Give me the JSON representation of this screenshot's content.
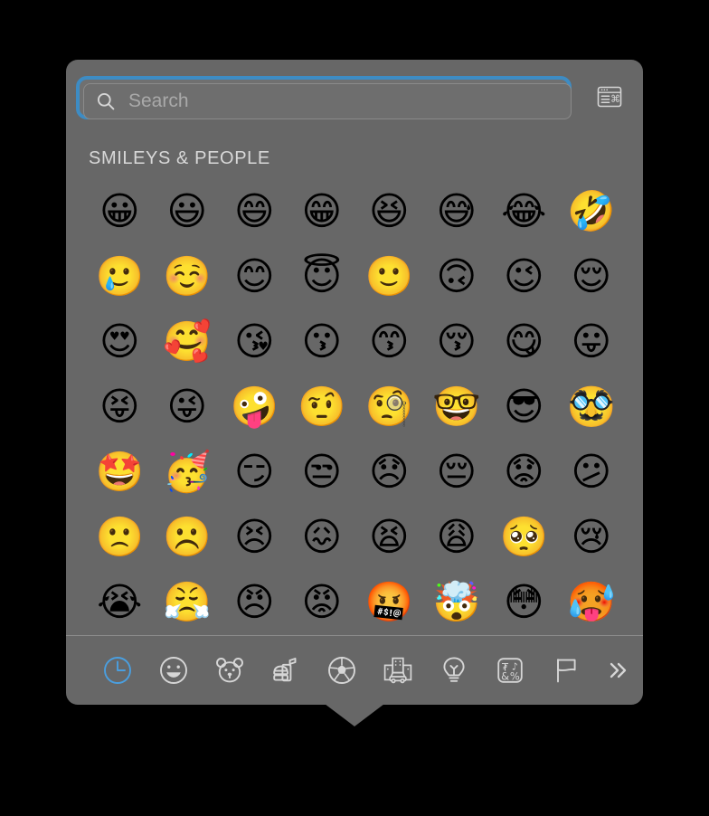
{
  "window": {
    "title": "Emoji Picker",
    "background_color": "#000000",
    "panel_color": "#676767",
    "accent_color": "#3d8cc4"
  },
  "search": {
    "value": "",
    "placeholder": "Search",
    "icon": "search-icon",
    "focused": true,
    "focus_ring_color": "#3d8cc4"
  },
  "char_viewer": {
    "icon": "character-viewer-icon",
    "label": "",
    "glyph": "⌘"
  },
  "section": {
    "header": "SMILEYS & PEOPLE"
  },
  "grid": {
    "columns": 8,
    "rows": 7,
    "emojis": [
      {
        "glyph": "😀",
        "name": "grinning-face"
      },
      {
        "glyph": "😃",
        "name": "grinning-face-with-big-eyes"
      },
      {
        "glyph": "😄",
        "name": "grinning-face-with-smiling-eyes"
      },
      {
        "glyph": "😁",
        "name": "beaming-face-with-smiling-eyes"
      },
      {
        "glyph": "😆",
        "name": "grinning-squinting-face"
      },
      {
        "glyph": "😅",
        "name": "grinning-face-with-sweat"
      },
      {
        "glyph": "😂",
        "name": "face-with-tears-of-joy"
      },
      {
        "glyph": "🤣",
        "name": "rolling-on-the-floor-laughing"
      },
      {
        "glyph": "🥲",
        "name": "smiling-face-with-tear"
      },
      {
        "glyph": "☺️",
        "name": "smiling-face"
      },
      {
        "glyph": "😊",
        "name": "smiling-face-with-smiling-eyes"
      },
      {
        "glyph": "😇",
        "name": "smiling-face-with-halo"
      },
      {
        "glyph": "🙂",
        "name": "slightly-smiling-face"
      },
      {
        "glyph": "🙃",
        "name": "upside-down-face"
      },
      {
        "glyph": "😉",
        "name": "winking-face"
      },
      {
        "glyph": "😌",
        "name": "relieved-face"
      },
      {
        "glyph": "😍",
        "name": "smiling-face-with-heart-eyes"
      },
      {
        "glyph": "🥰",
        "name": "smiling-face-with-hearts"
      },
      {
        "glyph": "😘",
        "name": "face-blowing-a-kiss"
      },
      {
        "glyph": "😗",
        "name": "kissing-face"
      },
      {
        "glyph": "😙",
        "name": "kissing-face-with-smiling-eyes"
      },
      {
        "glyph": "😚",
        "name": "kissing-face-with-closed-eyes"
      },
      {
        "glyph": "😋",
        "name": "face-savoring-food"
      },
      {
        "glyph": "😛",
        "name": "face-with-tongue"
      },
      {
        "glyph": "😝",
        "name": "squinting-face-with-tongue"
      },
      {
        "glyph": "😜",
        "name": "winking-face-with-tongue"
      },
      {
        "glyph": "🤪",
        "name": "zany-face"
      },
      {
        "glyph": "🤨",
        "name": "face-with-raised-eyebrow"
      },
      {
        "glyph": "🧐",
        "name": "face-with-monocle"
      },
      {
        "glyph": "🤓",
        "name": "nerd-face"
      },
      {
        "glyph": "😎",
        "name": "smiling-face-with-sunglasses"
      },
      {
        "glyph": "🥸",
        "name": "disguised-face"
      },
      {
        "glyph": "🤩",
        "name": "star-struck"
      },
      {
        "glyph": "🥳",
        "name": "partying-face"
      },
      {
        "glyph": "😏",
        "name": "smirking-face"
      },
      {
        "glyph": "😒",
        "name": "unamused-face"
      },
      {
        "glyph": "😞",
        "name": "disappointed-face"
      },
      {
        "glyph": "😔",
        "name": "pensive-face"
      },
      {
        "glyph": "😟",
        "name": "worried-face"
      },
      {
        "glyph": "😕",
        "name": "confused-face"
      },
      {
        "glyph": "🙁",
        "name": "slightly-frowning-face"
      },
      {
        "glyph": "☹️",
        "name": "frowning-face"
      },
      {
        "glyph": "😣",
        "name": "persevering-face"
      },
      {
        "glyph": "😖",
        "name": "confounded-face"
      },
      {
        "glyph": "😫",
        "name": "tired-face"
      },
      {
        "glyph": "😩",
        "name": "weary-face"
      },
      {
        "glyph": "🥺",
        "name": "pleading-face"
      },
      {
        "glyph": "😢",
        "name": "crying-face"
      },
      {
        "glyph": "😭",
        "name": "loudly-crying-face"
      },
      {
        "glyph": "😤",
        "name": "face-with-steam-from-nose"
      },
      {
        "glyph": "😠",
        "name": "angry-face"
      },
      {
        "glyph": "😡",
        "name": "pouting-face"
      },
      {
        "glyph": "🤬",
        "name": "face-with-symbols-on-mouth"
      },
      {
        "glyph": "🤯",
        "name": "exploding-head"
      },
      {
        "glyph": "😳",
        "name": "flushed-face"
      },
      {
        "glyph": "🥵",
        "name": "hot-face"
      }
    ]
  },
  "tabbar": {
    "selected_index": 0,
    "selected_color": "#4a9fe0",
    "items": [
      {
        "name": "tab-frequently-used",
        "icon": "clock-icon",
        "label": "Frequently Used"
      },
      {
        "name": "tab-smileys-people",
        "icon": "smiley-icon",
        "label": "Smileys & People"
      },
      {
        "name": "tab-animals-nature",
        "icon": "bear-icon",
        "label": "Animals & Nature"
      },
      {
        "name": "tab-food-drink",
        "icon": "food-drink-icon",
        "label": "Food & Drink"
      },
      {
        "name": "tab-activity",
        "icon": "soccer-ball-icon",
        "label": "Activity"
      },
      {
        "name": "tab-travel-places",
        "icon": "car-buildings-icon",
        "label": "Travel & Places"
      },
      {
        "name": "tab-objects",
        "icon": "lightbulb-icon",
        "label": "Objects"
      },
      {
        "name": "tab-symbols",
        "icon": "symbols-icon",
        "label": "Symbols"
      },
      {
        "name": "tab-flags",
        "icon": "flag-icon",
        "label": "Flags"
      }
    ],
    "overflow": {
      "name": "tab-overflow",
      "icon": "double-chevron-right-icon",
      "glyph": "»"
    }
  }
}
